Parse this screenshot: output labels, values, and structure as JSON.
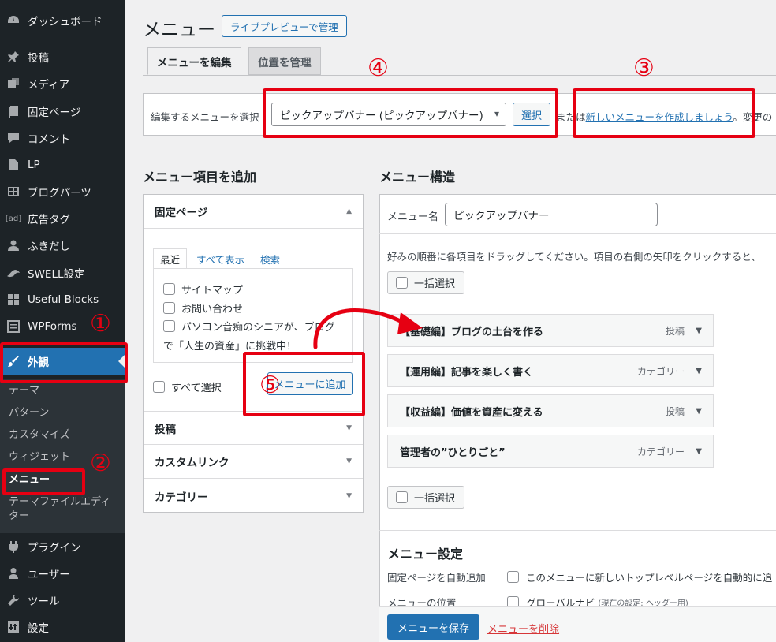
{
  "sidebar": {
    "items": [
      {
        "label": "ダッシュボード",
        "icon": "dashboard-icon"
      },
      {
        "label": "投稿",
        "icon": "pin-icon"
      },
      {
        "label": "メディア",
        "icon": "media-icon"
      },
      {
        "label": "固定ページ",
        "icon": "page-icon"
      },
      {
        "label": "コメント",
        "icon": "comment-icon"
      },
      {
        "label": "LP",
        "icon": "document-icon"
      },
      {
        "label": "ブログパーツ",
        "icon": "grid-icon"
      },
      {
        "label": "広告タグ",
        "icon": "ad-icon"
      },
      {
        "label": "ふきだし",
        "icon": "person-icon"
      },
      {
        "label": "SWELL設定",
        "icon": "swell-icon"
      },
      {
        "label": "Useful Blocks",
        "icon": "blocks-icon"
      },
      {
        "label": "WPForms",
        "icon": "form-icon"
      },
      {
        "label": "外観",
        "icon": "brush-icon"
      },
      {
        "label": "プラグイン",
        "icon": "plugin-icon"
      },
      {
        "label": "ユーザー",
        "icon": "user-icon"
      },
      {
        "label": "ツール",
        "icon": "wrench-icon"
      },
      {
        "label": "設定",
        "icon": "settings-icon"
      }
    ],
    "submenu": [
      "テーマ",
      "パターン",
      "カスタマイズ",
      "ウィジェット",
      "メニュー",
      "テーマファイルエディ",
      "ター"
    ]
  },
  "header": {
    "title": "メニュー",
    "live_preview_button": "ライブプレビューで管理",
    "tabs": [
      "メニューを編集",
      "位置を管理"
    ]
  },
  "menu_select": {
    "label": "編集するメニューを選択",
    "selected": "ピックアップバナー (ピックアップバナー)",
    "select_button": "選択",
    "or_text": "または",
    "create_link": "新しいメニューを作成しましょう",
    "after_text": "。変更の"
  },
  "add_items": {
    "heading": "メニュー項目を追加",
    "sections": [
      "固定ページ",
      "投稿",
      "カスタムリンク",
      "カテゴリー"
    ],
    "subtabs": [
      "最近",
      "すべて表示",
      "検索"
    ],
    "pages": [
      "サイトマップ",
      "お問い合わせ",
      "パソコン音痴のシニアが、ブログ"
    ],
    "page_wrap": "で「人生の資産」に挑戦中！",
    "select_all": "すべて選択",
    "add_button": "メニューに追加"
  },
  "structure": {
    "heading": "メニュー構造",
    "name_label": "メニュー名",
    "name_value": "ピックアップバナー",
    "hint": "好みの順番に各項目をドラッグしてください。項目の右側の矢印をクリックすると、",
    "bulk_select": "一括選択",
    "items": [
      {
        "title": "【基礎編】ブログの土台を作る",
        "type": "投稿"
      },
      {
        "title": "【運用編】記事を楽しく書く",
        "type": "カテゴリー"
      },
      {
        "title": "【収益編】価値を資産に変える",
        "type": "投稿"
      },
      {
        "title": "管理者の”ひとりごと”",
        "type": "カテゴリー"
      }
    ]
  },
  "settings": {
    "heading": "メニュー設定",
    "auto_add_label": "固定ページを自動追加",
    "auto_add_option": "このメニューに新しいトップレベルページを自動的に追",
    "location_label": "メニューの位置",
    "location_option": "グローバルナビ",
    "location_note": "(現在の設定: ヘッダー用)"
  },
  "footer": {
    "save_button": "メニューを保存",
    "delete_link": "メニューを削除"
  },
  "annotations": [
    "①",
    "②",
    "③",
    "④",
    "⑤"
  ],
  "colors": {
    "accent": "#2271b1",
    "annotation": "#e60012",
    "sidebar": "#1d2327"
  }
}
